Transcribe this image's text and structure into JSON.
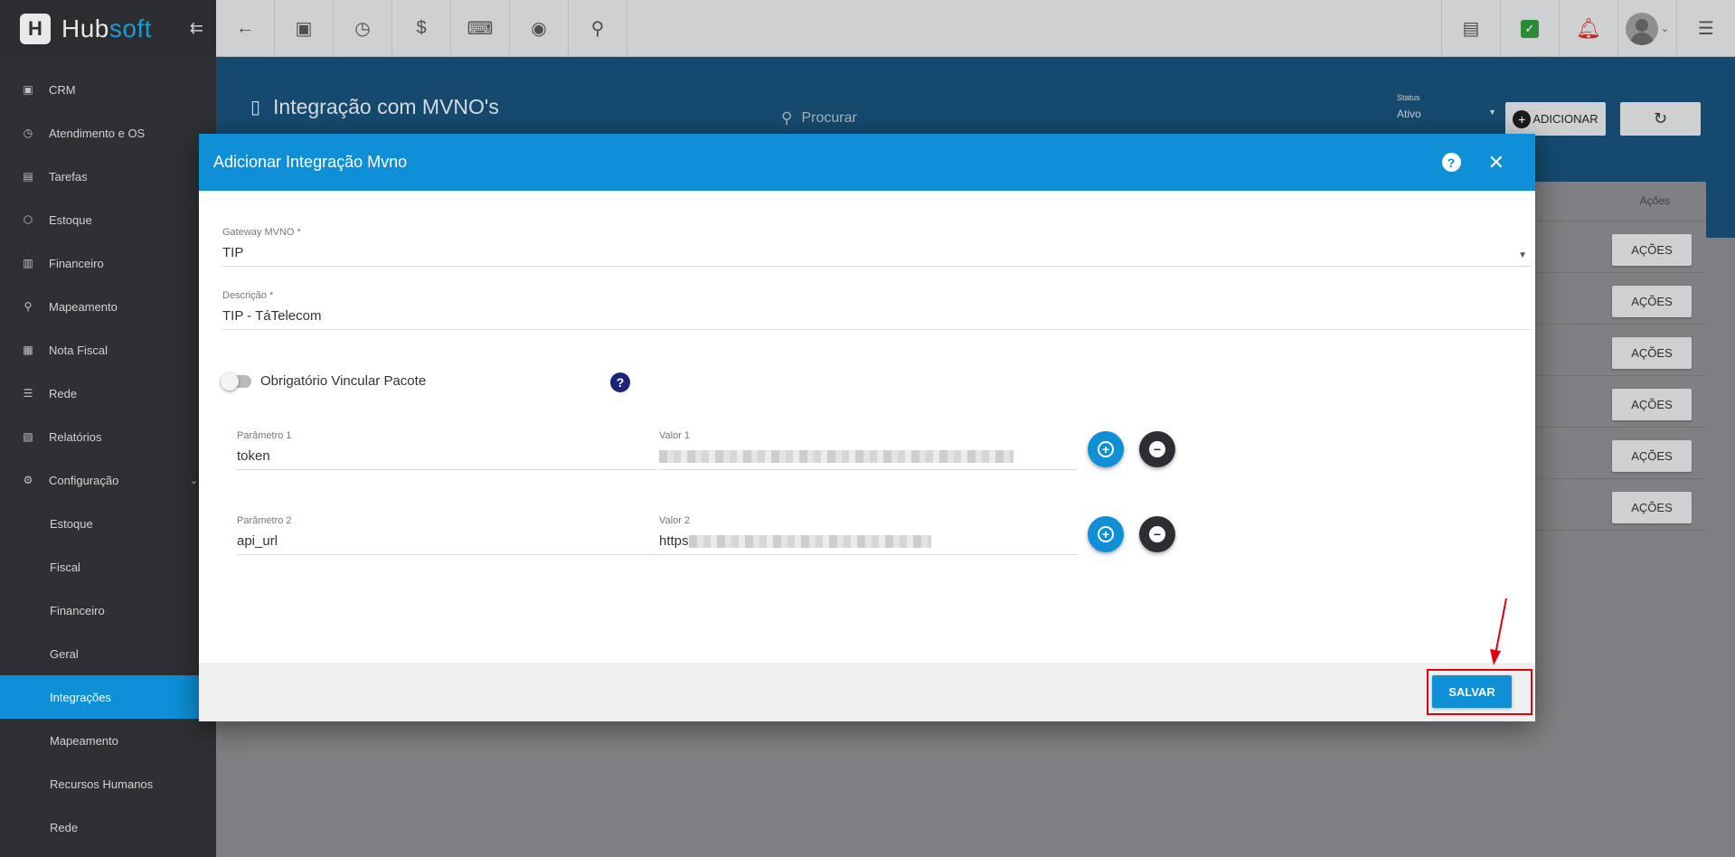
{
  "brand": {
    "name_main": "Hub",
    "name_accent": "soft",
    "collapse_glyph": "⇇"
  },
  "sidebar": {
    "items": [
      {
        "label": "CRM",
        "icon": "crm-board-icon",
        "glyph": "▣"
      },
      {
        "label": "Atendimento e OS",
        "icon": "calendar-clock-icon",
        "glyph": "◷"
      },
      {
        "label": "Tarefas",
        "icon": "tasks-icon",
        "glyph": "▤"
      },
      {
        "label": "Estoque",
        "icon": "box-icon",
        "glyph": "⬡"
      },
      {
        "label": "Financeiro",
        "icon": "money-icon",
        "glyph": "▥"
      },
      {
        "label": "Mapeamento",
        "icon": "map-pin-icon",
        "glyph": "⚲"
      },
      {
        "label": "Nota Fiscal",
        "icon": "invoice-icon",
        "glyph": "▦"
      },
      {
        "label": "Rede",
        "icon": "network-icon",
        "glyph": "☰"
      },
      {
        "label": "Relatórios",
        "icon": "report-file-icon",
        "glyph": "▧"
      },
      {
        "label": "Configuração",
        "icon": "gear-icon",
        "glyph": "⚙"
      }
    ],
    "subitems": [
      {
        "label": "Estoque"
      },
      {
        "label": "Fiscal"
      },
      {
        "label": "Financeiro"
      },
      {
        "label": "Geral"
      },
      {
        "label": "Integrações"
      },
      {
        "label": "Mapeamento"
      },
      {
        "label": "Recursos Humanos"
      },
      {
        "label": "Rede"
      }
    ]
  },
  "page": {
    "title": "Integração com MVNO's",
    "search_placeholder": "Procurar",
    "status_label": "Status",
    "status_value": "Ativo",
    "add_button": "ADICIONAR",
    "table_header_actions": "Ações",
    "actions_button": "AÇÕES"
  },
  "modal": {
    "title": "Adicionar Integração Mvno",
    "gateway_label": "Gateway MVNO *",
    "gateway_value": "TIP",
    "descricao_label": "Descrição *",
    "descricao_value": "TIP - TáTelecom",
    "toggle_label": "Obrigatório Vincular Pacote",
    "params": [
      {
        "param_label": "Parâmetro 1",
        "param_value": "token",
        "value_label": "Valor 1",
        "value_value": ""
      },
      {
        "param_label": "Parâmetro 2",
        "param_value": "api_url",
        "value_label": "Valor 2",
        "value_value": "https"
      }
    ],
    "save_button": "SALVAR"
  },
  "colors": {
    "primary": "#0e8fd6",
    "sidebar": "#2e3033",
    "annotation": "#e3000f"
  }
}
